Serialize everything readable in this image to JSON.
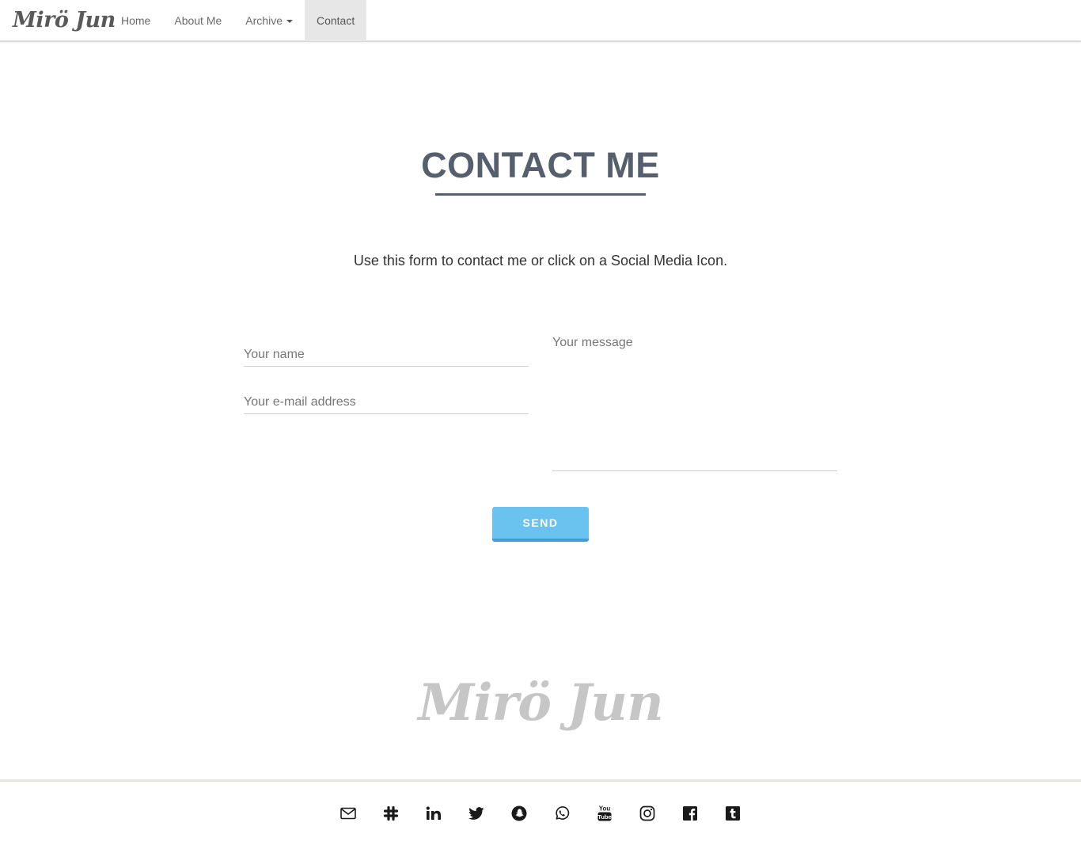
{
  "navbar": {
    "brand": "Mirö Jun",
    "items": [
      {
        "label": "Home"
      },
      {
        "label": "About Me"
      },
      {
        "label": "Archive"
      },
      {
        "label": "Contact"
      }
    ],
    "active": "Contact"
  },
  "main": {
    "title": "CONTACT ME",
    "intro": "Use this form to contact me or click on a Social Media Icon.",
    "form": {
      "name_placeholder": "Your name",
      "email_placeholder": "Your e-mail address",
      "message_placeholder": "Your message",
      "send_label": "SEND"
    }
  },
  "footer": {
    "logo": "Mirö Jun",
    "social_icons": [
      "envelope-icon",
      "slack-icon",
      "linkedin-icon",
      "twitter-icon",
      "snapchat-icon",
      "whatsapp-icon",
      "youtube-icon",
      "instagram-icon",
      "facebook-icon",
      "tumblr-icon"
    ]
  },
  "colors": {
    "heading": "#555f6e",
    "send_button": "#6ac3ef",
    "send_button_shadow": "#3f9fd4",
    "footer_logo": "#c6c6c6",
    "active_nav_bg": "#e7e7e7"
  }
}
